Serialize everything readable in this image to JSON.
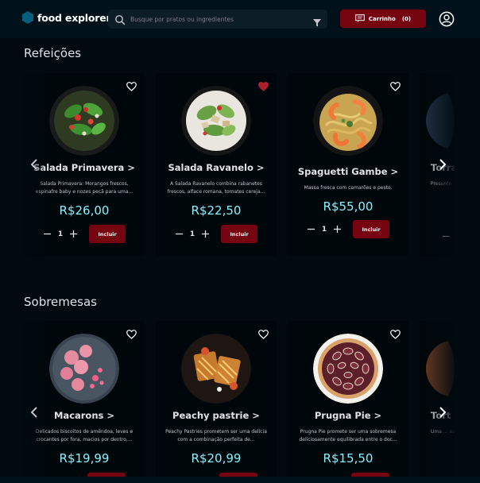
{
  "header": {
    "logo_text": "food explorer",
    "search_placeholder": "Busque por pratos ou ingredientes",
    "cart_label": "Carrinho",
    "cart_count": "(0)"
  },
  "sections": [
    {
      "title": "Refeições",
      "cards": [
        {
          "name": "Salada Primavera >",
          "desc": "Salada Primavera: Morangos frescos, espinafre baby e nozes pecã para uma...",
          "price": "R$26,00",
          "qty": "1",
          "add_label": "Incluir",
          "favorited": false
        },
        {
          "name": "Salada Ravanelo >",
          "desc": "A Salada Ravanelo combina rabanetes frescos, alface romana, tomates cereja...",
          "price": "R$22,50",
          "qty": "1",
          "add_label": "Incluir",
          "favorited": true
        },
        {
          "name": "Spaguetti Gambe >",
          "desc": "Massa fresca com camarões e pesto.",
          "price": "R$55,00",
          "qty": "1",
          "add_label": "Incluir",
          "favorited": false
        },
        {
          "name": "Torra",
          "desc": "Presunto ... co",
          "price": "",
          "qty": "",
          "add_label": "",
          "favorited": false
        }
      ]
    },
    {
      "title": "Sobremesas",
      "cards": [
        {
          "name": "Macarons >",
          "desc": "Delicados biscoitos de amêndoa, leves e crocantes por fora, macios por dentro,...",
          "price": "R$19,99",
          "qty": "",
          "add_label": "",
          "favorited": false
        },
        {
          "name": "Peachy pastrie >",
          "desc": "Peachy Pastries prometem ser uma delícia com a combinação perfeita de...",
          "price": "R$20,99",
          "qty": "",
          "add_label": "",
          "favorited": false
        },
        {
          "name": "Prugna Pie >",
          "desc": "Prugna Pie promete ser uma sobremesa deliciosamente equilibrada entre o doc...",
          "price": "R$15,50",
          "qty": "",
          "add_label": "",
          "favorited": false
        },
        {
          "name": "Tort",
          "desc": "Uma ... suculen",
          "price": "",
          "qty": "",
          "add_label": "",
          "favorited": false
        }
      ]
    }
  ],
  "colors": {
    "background": "#000a0f",
    "header": "#00111a",
    "card": "#00070a",
    "accent_red": "#750310",
    "price_cyan": "#82f3ff",
    "logo_blue": "#065e7c"
  }
}
